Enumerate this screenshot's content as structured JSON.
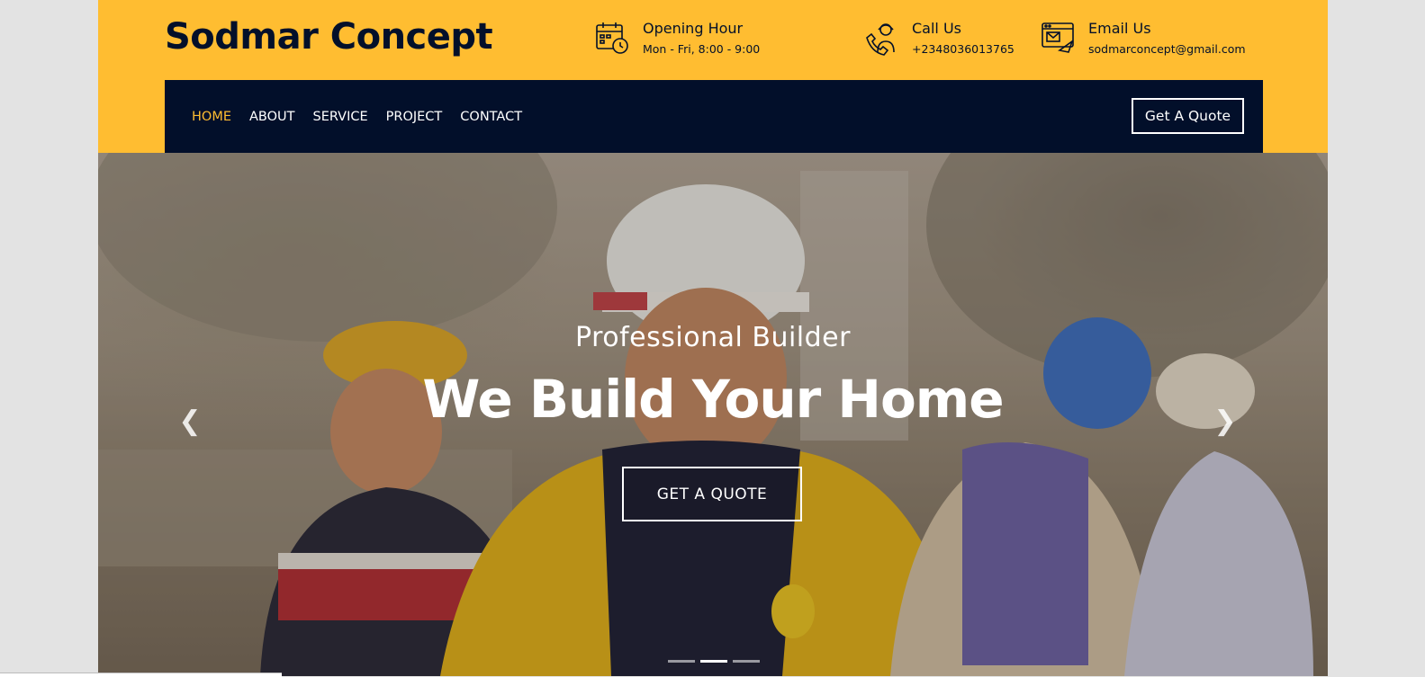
{
  "header": {
    "brand": "Sodmar Concept",
    "opening": {
      "title": "Opening Hour",
      "value": "Mon - Fri, 8:00 - 9:00",
      "icon": "calendar-clock-icon"
    },
    "call": {
      "title": "Call Us",
      "value": "+2348036013765",
      "icon": "phone-support-icon"
    },
    "email": {
      "title": "Email Us",
      "value": "sodmarconcept@gmail.com",
      "icon": "email-icon"
    }
  },
  "nav": {
    "items": [
      {
        "label": "HOME",
        "active": true
      },
      {
        "label": "ABOUT"
      },
      {
        "label": "SERVICE"
      },
      {
        "label": "PROJECT"
      },
      {
        "label": "CONTACT"
      }
    ],
    "quote_label": "Get A Quote"
  },
  "hero": {
    "subtitle": "Professional Builder",
    "title": "We Build Your Home",
    "button": "GET A QUOTE",
    "slides": 3,
    "active_slide": 2,
    "prev_icon": "chevron-left-icon",
    "next_icon": "chevron-right-icon"
  },
  "colors": {
    "accent": "#ffbd31",
    "navy": "#020f2a"
  }
}
